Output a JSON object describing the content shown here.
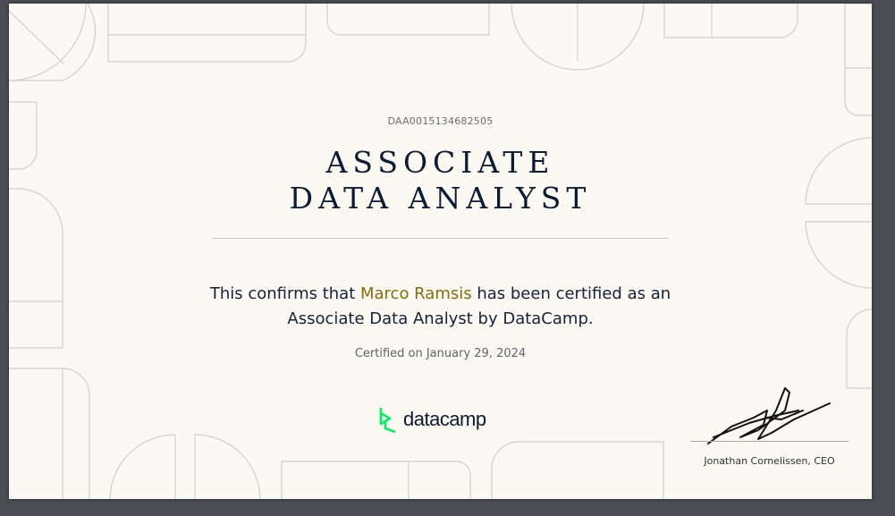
{
  "certificate": {
    "id": "DAA0015134682505",
    "title_line1": "ASSOCIATE",
    "title_line2": "DATA ANALYST",
    "statement_prefix": "This confirms that ",
    "recipient_name": "Marco Ramsis",
    "statement_middle": " has been certified as an",
    "statement_line2": "Associate Data Analyst by DataCamp.",
    "certified_date": "Certified on January 29, 2024",
    "signer": "Jonathan Cornelissen, CEO"
  },
  "brand": {
    "logo_text": "datacamp",
    "logo_icon": "datacamp-logo-icon",
    "accent_color": "#03ef62",
    "name_color": "#8b6a0f",
    "ink_color": "#0b1b33"
  }
}
